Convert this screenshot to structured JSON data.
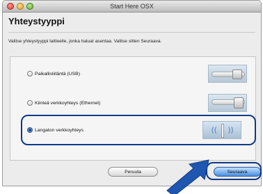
{
  "window": {
    "title": "Start Here OSX"
  },
  "page": {
    "heading": "Yhteystyyppi",
    "instruction": "Valitse yhteystyyppi laitteelle, jonka haluat asentaa. Valitse sitten Seuraava."
  },
  "options": [
    {
      "label": "Paikallisliitäntä (USB)",
      "selected": false,
      "icon": "usb-cable-icon"
    },
    {
      "label": "Kiinteä verkkoyhteys (Ethernet)",
      "selected": false,
      "icon": "ethernet-cable-icon"
    },
    {
      "label": "Langaton verkkoyhteys",
      "selected": true,
      "icon": "wireless-signal-icon"
    }
  ],
  "buttons": {
    "cancel": "Peruuta",
    "next": "Seuraava"
  },
  "colors": {
    "highlight": "#0c3a88",
    "arrow": "#1e56b0",
    "primary_button": "#4a8fde"
  }
}
